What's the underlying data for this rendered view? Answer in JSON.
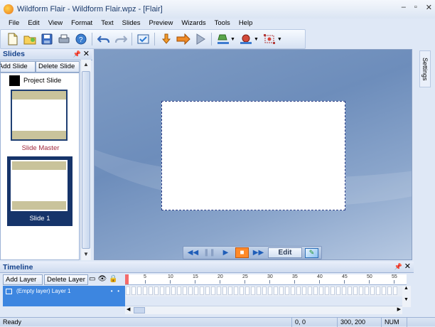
{
  "window": {
    "title": "Wildform Flair  - Wildform Flair.wpz - [Flair]",
    "controls": [
      "–",
      "▫",
      "✕"
    ]
  },
  "menu": [
    "File",
    "Edit",
    "View",
    "Format",
    "Text",
    "Slides",
    "Preview",
    "Wizards",
    "Tools",
    "Help"
  ],
  "slides_panel": {
    "title": "Slides",
    "add_slide": "Add Slide",
    "delete_slide": "Delete Slide",
    "project_slide": "Project Slide",
    "master_label": "Slide Master",
    "slide1_label": "Slide 1"
  },
  "settings": {
    "tab_label": "Settings"
  },
  "playback": {
    "edit_label": "Edit"
  },
  "timeline": {
    "title": "Timeline",
    "add_layer": "Add Layer",
    "delete_layer": "Delete Layer",
    "layer_name": "(Empty layer) Layer 1",
    "ruler_labels": [
      "5",
      "10",
      "15",
      "20",
      "25",
      "30",
      "35",
      "40",
      "45",
      "50",
      "55"
    ]
  },
  "status": {
    "ready": "Ready",
    "pos": "0, 0",
    "size": "300, 200",
    "num": "NUM"
  },
  "colors": {
    "selection": "#3d86e0",
    "stage": "#6d8dbb",
    "accent": "#ff8a2a"
  }
}
